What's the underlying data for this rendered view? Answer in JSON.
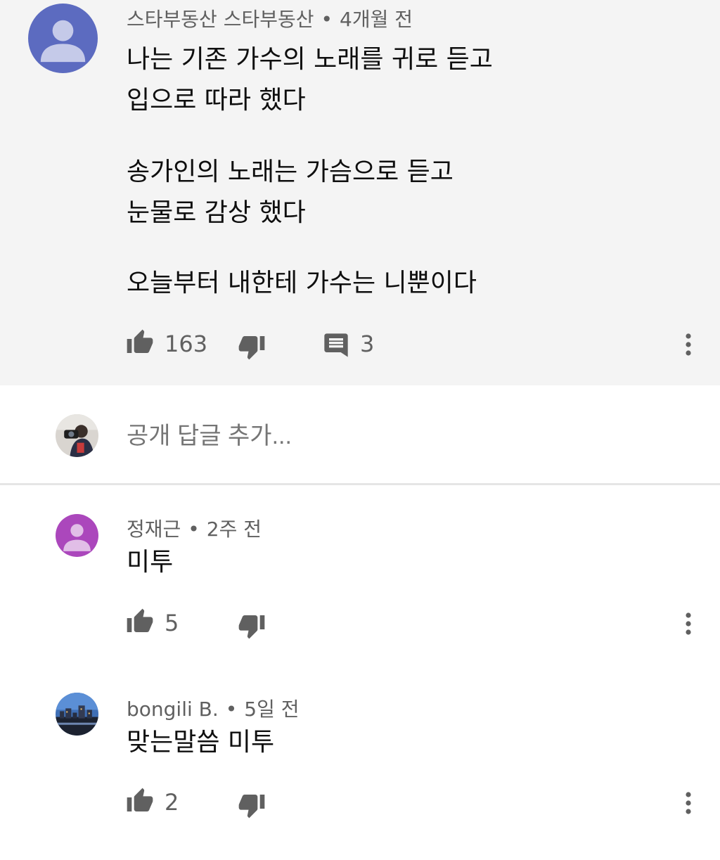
{
  "main_comment": {
    "author": "스타부동산 스타부동산",
    "separator": "•",
    "time": "4개월 전",
    "lines": [
      "나는 기존 가수의 노래를 귀로 듣고",
      "입으로 따라 했다",
      "송가인의 노래는 가슴으로 듣고",
      "눈물로 감상 했다",
      "오늘부터 내한테 가수는 니뿐이다"
    ],
    "likes": "163",
    "replies": "3",
    "avatar_color": "#5c6bc0"
  },
  "reply_box": {
    "placeholder": "공개 답글 추가..."
  },
  "replies": [
    {
      "author": "정재근",
      "separator": "•",
      "time": "2주 전",
      "text": "미투",
      "likes": "5",
      "avatar_color": "#ab47bc"
    },
    {
      "author": "bongili B.",
      "separator": "•",
      "time": "5일 전",
      "text": "맞는말씀 미투",
      "likes": "2"
    }
  ],
  "icons": {
    "like": "thumb-up-icon",
    "dislike": "thumb-down-icon",
    "reply": "comment-icon",
    "more": "more-vert-icon"
  },
  "colors": {
    "highlight_bg": "#f4f4f4",
    "secondary_text": "#606060",
    "placeholder_text": "#909090"
  }
}
